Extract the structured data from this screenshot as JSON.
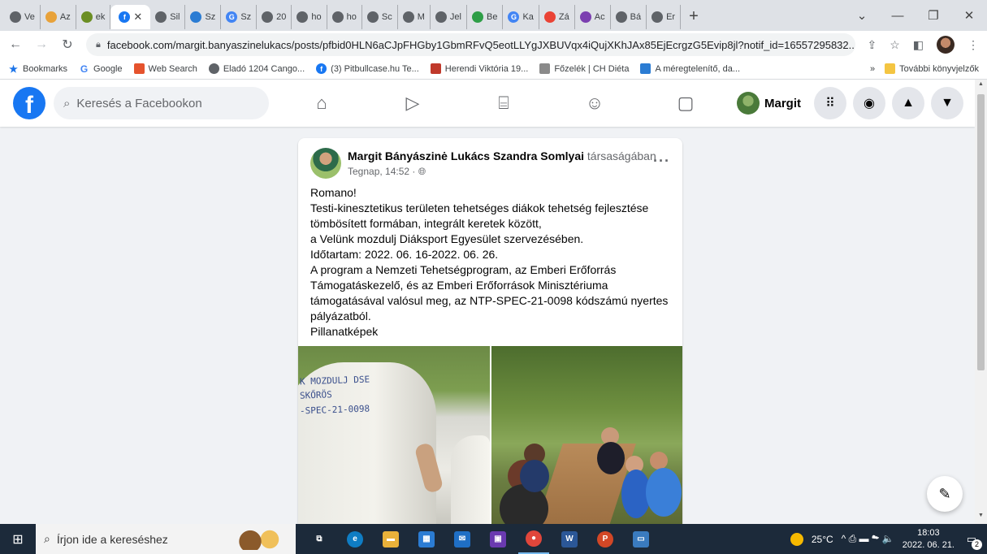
{
  "browser": {
    "tabs": [
      {
        "label": "Ve",
        "icon": "globe-icon",
        "color": "#5f6368"
      },
      {
        "label": "Az",
        "icon": "doc-icon",
        "color": "#e8a23a"
      },
      {
        "label": "ek",
        "icon": "bug-icon",
        "color": "#6b8e23"
      },
      {
        "label": "",
        "icon": "facebook-icon",
        "color": "#1877f2",
        "active": true
      },
      {
        "label": "Sil",
        "icon": "globe-icon",
        "color": "#5f6368"
      },
      {
        "label": "Sz",
        "icon": "grid-icon",
        "color": "#2b7cd3"
      },
      {
        "label": "Sz",
        "icon": "google-icon",
        "color": "#4285f4"
      },
      {
        "label": "20",
        "icon": "globe-icon",
        "color": "#5f6368"
      },
      {
        "label": "ho",
        "icon": "globe-icon",
        "color": "#5f6368"
      },
      {
        "label": "ho",
        "icon": "globe-icon",
        "color": "#5f6368"
      },
      {
        "label": "Sc",
        "icon": "globe-icon",
        "color": "#5f6368"
      },
      {
        "label": "M",
        "icon": "globe-icon",
        "color": "#5f6368"
      },
      {
        "label": "Jel",
        "icon": "globe-icon",
        "color": "#5f6368"
      },
      {
        "label": "Be",
        "icon": "plus-square-icon",
        "color": "#2e9e47"
      },
      {
        "label": "Ka",
        "icon": "google-icon",
        "color": "#4285f4"
      },
      {
        "label": "Zá",
        "icon": "gmail-icon",
        "color": "#ea4335"
      },
      {
        "label": "Ac",
        "icon": "list-icon",
        "color": "#7b3fb0"
      },
      {
        "label": "Bá",
        "icon": "globe-icon",
        "color": "#5f6368"
      },
      {
        "label": "Er",
        "icon": "globe-icon",
        "color": "#5f6368"
      }
    ],
    "active_tab_close": "✕",
    "new_tab": "+",
    "window_controls": {
      "collapse": "⌄",
      "minimize": "—",
      "restore": "❐",
      "close": "✕"
    },
    "url": "facebook.com/margit.banyaszinelukacs/posts/pfbid0HLN6aCJpFHGby1GbmRFvQ5eotLLYgJXBUVqx4iQujXKhJAx85EjEcrgzG5Evip8jl?notif_id=16557295832...",
    "bookmarks": [
      {
        "label": "Bookmarks",
        "icon": "star-icon",
        "color": "#1a73e8"
      },
      {
        "label": "Google",
        "icon": "google-icon",
        "color": "#4285f4"
      },
      {
        "label": "Web Search",
        "icon": "web-search-icon",
        "color": "#e5532d"
      },
      {
        "label": "Eladó 1204 Cango...",
        "icon": "globe-icon",
        "color": "#5f6368"
      },
      {
        "label": "(3) Pitbullcase.hu Te...",
        "icon": "facebook-icon",
        "color": "#1877f2"
      },
      {
        "label": "Herendi Viktória 19...",
        "icon": "herendi-icon",
        "color": "#c0392b"
      },
      {
        "label": "Főzelék | CH Diéta",
        "icon": "diet-icon",
        "color": "#8a8a8a"
      },
      {
        "label": "A méregtelenítő, da...",
        "icon": "mail-icon",
        "color": "#2b7cd3"
      }
    ],
    "more_bookmarks_chevron": "»",
    "other_bookmarks": "További könyvjelzők"
  },
  "facebook": {
    "search_placeholder": "Keresés a Facebookon",
    "profile_name": "Margit"
  },
  "post": {
    "author": "Margit Bányászinė Lukács Szandra Somlyai",
    "author_suffix": "társaságában",
    "timestamp": "Tegnap, 14:52 ·",
    "lines": [
      "Romano!",
      "Testi-kinesztetikus területen tehetséges diákok tehetség fejlesztése",
      "tömbösített formában, integrált keretek között,",
      "a Velünk mozdulj Diáksport Egyesület szervezésében.",
      "Időtartam: 2022. 06. 16-2022. 06. 26.",
      "A program a Nemzeti Tehetségprogram, az Emberi Erőforrás",
      "Támogatáskezelő, és az Emberi Erőforrások Minisztériuma",
      "támogatásával valósul meg, az NTP-SPEC-21-0098 kódszámú nyertes",
      "pályázatból.",
      "Pillanatképek"
    ],
    "shirt_text": [
      "K MOZDULJ DSE",
      "SKŐRÖS",
      "-SPEC-21-0098"
    ]
  },
  "taskbar": {
    "search_placeholder": "Írjon ide a kereséshez",
    "apps": [
      {
        "name": "task-view",
        "glyph": "⧉",
        "color": "#1c2a3a"
      },
      {
        "name": "edge",
        "glyph": "e",
        "color": "#0f7dc4"
      },
      {
        "name": "file-explorer",
        "glyph": "▬",
        "color": "#e8b13a"
      },
      {
        "name": "store",
        "glyph": "▦",
        "color": "#2b7cd3"
      },
      {
        "name": "mail",
        "glyph": "✉",
        "color": "#1f6fc5"
      },
      {
        "name": "save",
        "glyph": "▣",
        "color": "#6a3ab0"
      },
      {
        "name": "chrome",
        "glyph": "●",
        "color": "#e0463b",
        "running": true
      },
      {
        "name": "word",
        "glyph": "W",
        "color": "#2b5797"
      },
      {
        "name": "powerpoint",
        "glyph": "P",
        "color": "#d24726"
      },
      {
        "name": "photos",
        "glyph": "▭",
        "color": "#3a7bbf"
      }
    ],
    "temperature": "25°C",
    "tray_icons": "^ ⎙ ▬ ☁ 🔈",
    "time": "18:03",
    "date": "2022. 06. 21.",
    "notifications": "2"
  }
}
